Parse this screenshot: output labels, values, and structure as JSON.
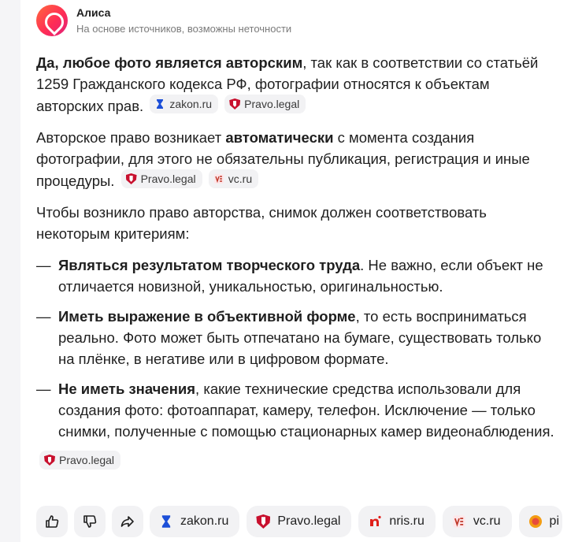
{
  "header": {
    "title": "Алиса",
    "subtitle": "На основе источников, возможны неточности"
  },
  "content": {
    "p1": {
      "bold": "Да, любое фото является авторским",
      "text": ", так как в соответствии со статьёй 1259 Гражданского кодекса РФ, фотографии относятся к объектам авторских прав.",
      "sources": [
        "zakon.ru",
        "Pravo.legal"
      ]
    },
    "p2": {
      "pre": "Авторское право возникает ",
      "bold": "автоматически",
      "text": " с момента создания фотографии, для этого не обязательны публикация, регистрация и иные процедуры.",
      "sources": [
        "Pravo.legal",
        "vc.ru"
      ]
    },
    "p3": {
      "text": "Чтобы возникло право авторства, снимок должен соответствовать некоторым критериям:"
    },
    "list": [
      {
        "dash": "—",
        "bold": "Являться результатом творческого труда",
        "text": ". Не важно, если объект не отличается новизной, уникальностью, оригинальностью."
      },
      {
        "dash": "—",
        "bold": "Иметь выражение в объективной форме",
        "text": ", то есть восприниматься реально. Фото может быть отпечатано на бумаге, существовать только на плёнке, в негативе или в цифровом формате."
      },
      {
        "dash": "—",
        "bold": "Не иметь значения",
        "text": ", какие технические средства использовали для создания фото: фотоаппарат, камеру, телефон. Исключение — только снимки, полученные с помощью стационарных камер видеонаблюдения."
      }
    ],
    "list_source": "Pravo.legal"
  },
  "actions": {
    "icons": [
      "thumbs-up-icon",
      "thumbs-down-icon",
      "share-icon"
    ]
  },
  "sources_bar": [
    "zakon.ru",
    "Pravo.legal",
    "nris.ru",
    "vc.ru",
    "pi"
  ],
  "colors": {
    "accent_avatar": "#ff2d55",
    "chip_bg": "#f2f2f4",
    "pravo_red": "#c8102e",
    "zakon_blue": "#1c4fd8"
  }
}
